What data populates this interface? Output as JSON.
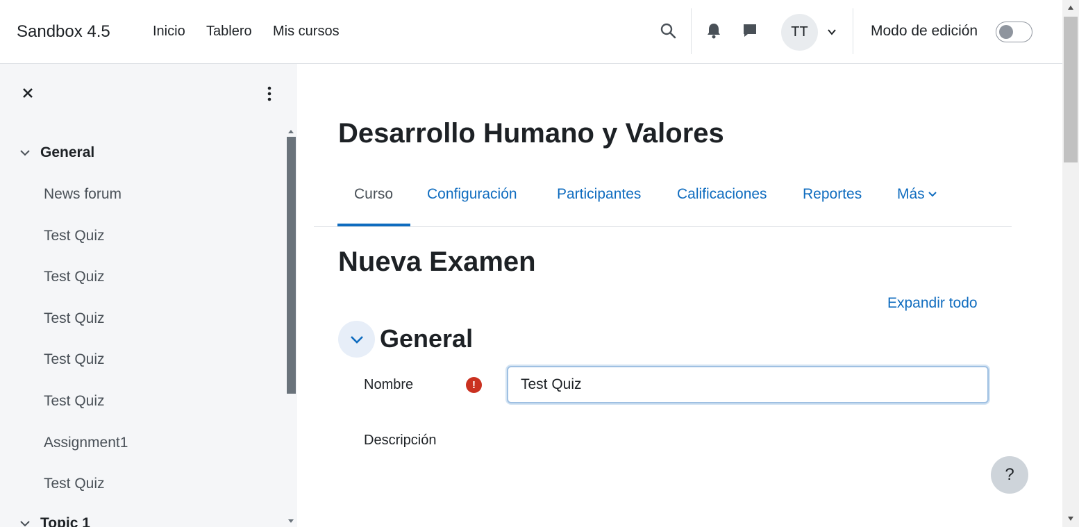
{
  "navbar": {
    "brand": "Sandbox 4.5",
    "links": [
      "Inicio",
      "Tablero",
      "Mis cursos"
    ],
    "icons": [
      "search-icon",
      "bell-icon",
      "chat-bubble-icon"
    ],
    "avatar_initials": "TT",
    "edit_mode_label": "Modo de edición",
    "edit_mode_on": false
  },
  "drawer": {
    "sections": [
      {
        "label": "General",
        "expanded": true,
        "items": [
          "News forum",
          "Test Quiz",
          "Test Quiz",
          "Test Quiz",
          "Test Quiz",
          "Test Quiz",
          "Assignment1",
          "Test Quiz"
        ]
      },
      {
        "label": "Topic 1",
        "expanded": true,
        "items": []
      }
    ]
  },
  "main": {
    "course_title": "Desarrollo Humano y Valores",
    "tabs": [
      {
        "label": "Curso",
        "active": true
      },
      {
        "label": "Configuración",
        "active": false
      },
      {
        "label": "Participantes",
        "active": false
      },
      {
        "label": "Calificaciones",
        "active": false
      },
      {
        "label": "Reportes",
        "active": false
      },
      {
        "label": "Más",
        "active": false
      }
    ],
    "page_heading": "Nueva Examen",
    "expand_all": "Expandir todo",
    "fieldset_legend": "General",
    "fields": {
      "name_label": "Nombre",
      "name_value": "Test Quiz",
      "description_label": "Descripción"
    },
    "help_button": "?"
  },
  "colors": {
    "link": "#0f6cbf",
    "required": "#ca3120",
    "drawer_bg": "#f5f6f8"
  }
}
